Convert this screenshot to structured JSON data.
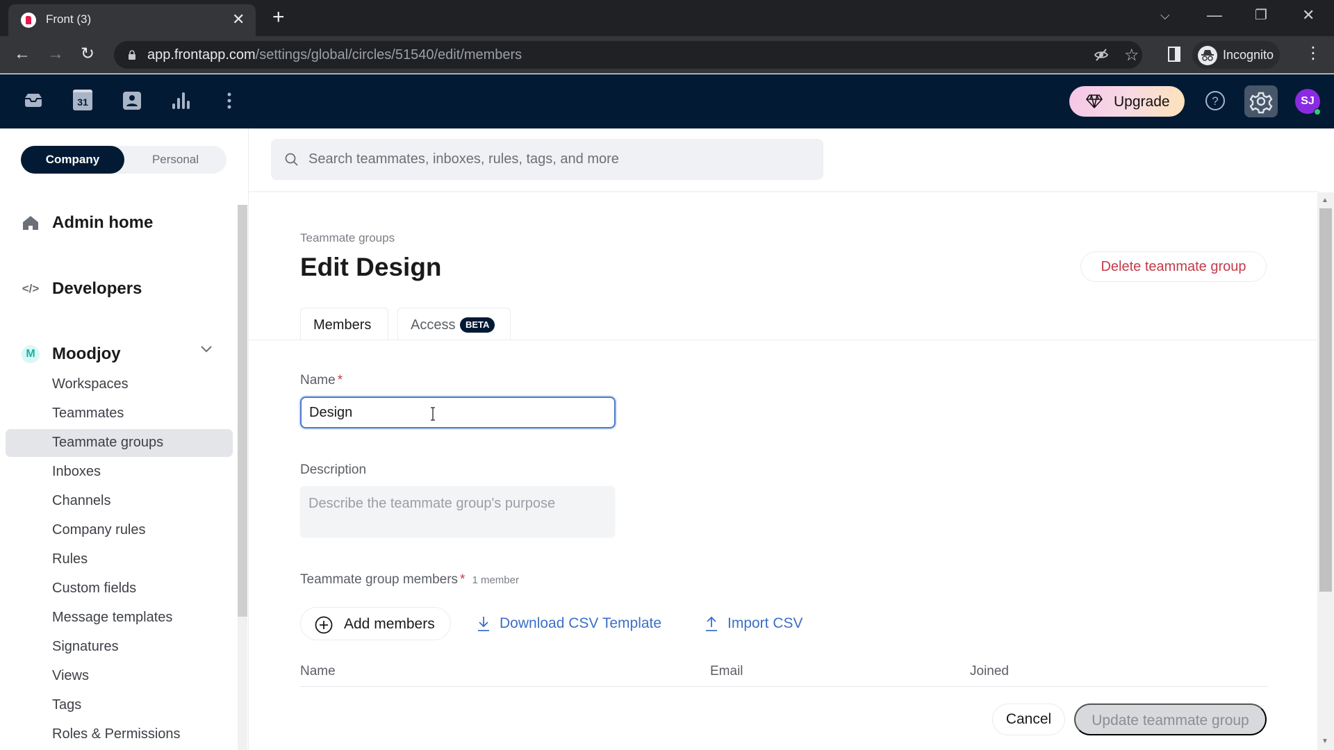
{
  "browser": {
    "tab_title": "Front (3)",
    "url_host": "app.frontapp.com",
    "url_path": "/settings/global/circles/51540/edit/members",
    "profile_label": "Incognito"
  },
  "appbar": {
    "icons": [
      "inbox-icon",
      "calendar-icon",
      "contacts-icon",
      "analytics-icon",
      "more-icon"
    ],
    "calendar_day": "31",
    "upgrade_label": "Upgrade",
    "avatar_initials": "SJ",
    "avatar_color": "#8a2be2",
    "status_color": "#2ecc71"
  },
  "sidebar": {
    "scope": {
      "company": "Company",
      "personal": "Personal",
      "selected": "Company"
    },
    "admin_home": "Admin home",
    "developers": "Developers",
    "developers_glyph": "</>",
    "workspace": {
      "badge": "M",
      "name": "Moodjoy"
    },
    "items": [
      {
        "label": "Workspaces",
        "active": false
      },
      {
        "label": "Teammates",
        "active": false
      },
      {
        "label": "Teammate groups",
        "active": true
      },
      {
        "label": "Inboxes",
        "active": false
      },
      {
        "label": "Channels",
        "active": false
      },
      {
        "label": "Company rules",
        "active": false
      },
      {
        "label": "Rules",
        "active": false
      },
      {
        "label": "Custom fields",
        "active": false
      },
      {
        "label": "Message templates",
        "active": false
      },
      {
        "label": "Signatures",
        "active": false
      },
      {
        "label": "Views",
        "active": false
      },
      {
        "label": "Tags",
        "active": false
      },
      {
        "label": "Roles & Permissions",
        "active": false
      }
    ]
  },
  "search": {
    "placeholder": "Search teammates, inboxes, rules, tags, and more"
  },
  "page": {
    "breadcrumb": "Teammate groups",
    "title": "Edit Design",
    "delete_label": "Delete teammate group",
    "tabs": [
      {
        "label": "Members",
        "active": true
      },
      {
        "label": "Access",
        "badge": "BETA",
        "active": false
      }
    ]
  },
  "form": {
    "name_label": "Name",
    "required_mark": "*",
    "name_value": "Design",
    "description_label": "Description",
    "description_placeholder": "Describe the teammate group's purpose",
    "description_value": "",
    "members_label": "Teammate group members",
    "member_count": "1 member",
    "add_members_label": "Add members",
    "download_csv_label": "Download CSV Template",
    "import_csv_label": "Import CSV",
    "columns": [
      "Name",
      "Email",
      "Joined"
    ],
    "rows": [],
    "cancel_label": "Cancel",
    "update_label": "Update teammate group"
  },
  "colors": {
    "appbar_bg": "#031a35",
    "danger": "#c33b4a",
    "link": "#3b6fc6",
    "focus": "#4a78c9"
  }
}
